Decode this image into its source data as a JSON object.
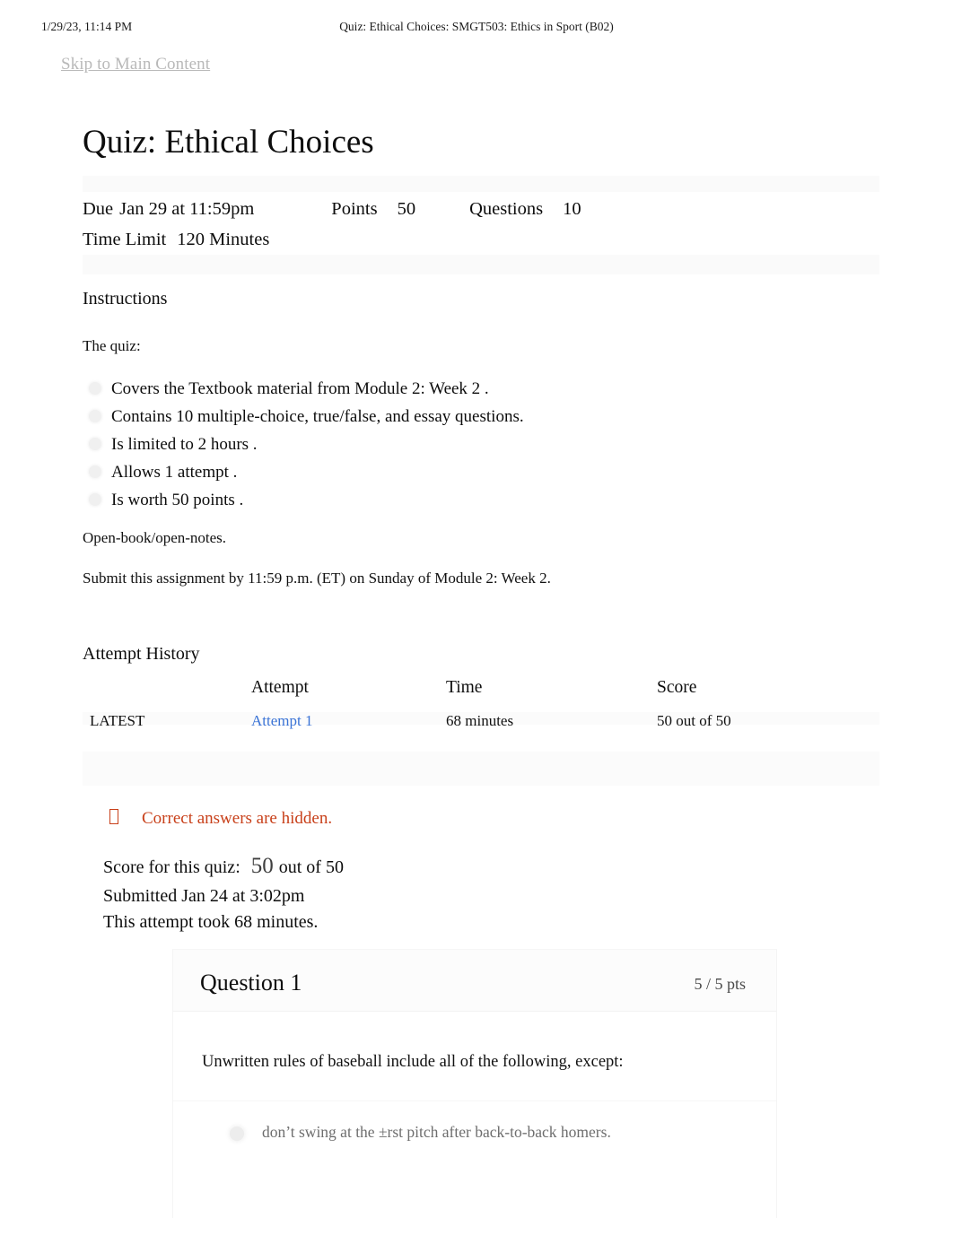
{
  "print_header": {
    "date": "1/29/23, 11:14 PM",
    "title": "Quiz: Ethical Choices: SMGT503: Ethics in Sport (B02)"
  },
  "skip_link": "Skip to Main Content",
  "page_title": "Quiz: Ethical Choices",
  "meta": {
    "due_label": "Due",
    "due_value": "Jan 29 at 11:59pm",
    "points_label": "Points",
    "points_value": "50",
    "questions_label": "Questions",
    "questions_value": "10",
    "time_limit_label": "Time Limit",
    "time_limit_value": "120 Minutes"
  },
  "instructions": {
    "heading": "Instructions",
    "intro": "The quiz:",
    "bullets": [
      "Covers the   Textbook   material from   Module 2: Week 2   .",
      "Contains   10 multiple-choice, true/false, and essay        questions.",
      "Is limited  to  2 hours  .",
      "Allows  1 attempt   .",
      "Is worth 50 points   ."
    ],
    "note_open_book": "Open-book/open-notes.",
    "note_submit": "Submit this assignment by 11:59 p.m. (ET) on Sunday of Module 2: Week 2."
  },
  "attempt_history": {
    "heading": "Attempt History",
    "columns": [
      "",
      "Attempt",
      "Time",
      "Score"
    ],
    "rows": [
      {
        "latest": "LATEST",
        "attempt": "Attempt 1",
        "time": "68 minutes",
        "score": "50 out of 50"
      }
    ]
  },
  "score_summary": {
    "answers_hidden": "Correct answers are hidden.",
    "answers_hidden_icon": "tofu-box-icon",
    "score_label": "Score for this quiz:",
    "score_value": "50",
    "score_suffix": "out of 50",
    "submitted": "Submitted Jan 24 at 3:02pm",
    "duration": "This attempt took 68 minutes."
  },
  "question": {
    "title": "Question 1",
    "points": "5 / 5 pts",
    "prompt": "Unwritten rules of baseball include all of the following, except:",
    "answers": [
      "don’t swing at the ±rst pitch after back-to-back homers."
    ]
  },
  "colors": {
    "link_blue": "#3a73d6",
    "warning_orange": "#c8401a",
    "muted_grey": "#6e6e6e",
    "skip_grey": "#b9b9b9"
  }
}
